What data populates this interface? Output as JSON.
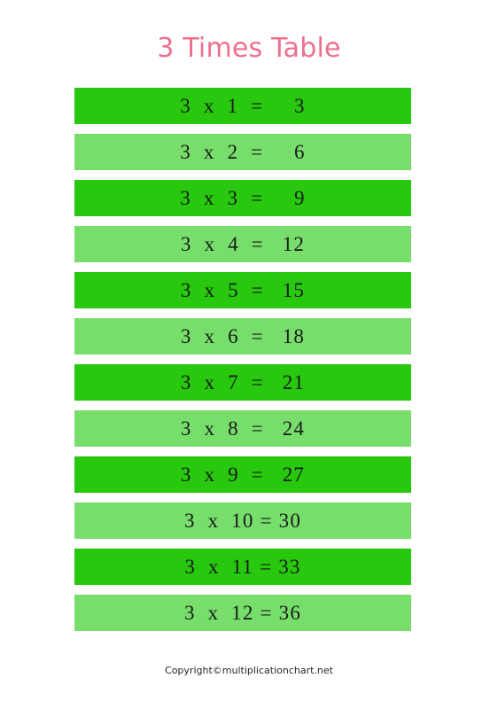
{
  "page": {
    "title": "3 Times Table",
    "title_color": "#ee6f90",
    "background_color": "#ffffff"
  },
  "colors": {
    "row_dark_green": "#27c80d",
    "row_light_green": "#77de6b",
    "text_color": "#1a1a1a"
  },
  "table": {
    "multiplier": "3",
    "operator": "x",
    "equals": "=",
    "rows": [
      {
        "line": "3  x  1  =     3",
        "multiplicand": "3",
        "multiplier": "1",
        "product": "3",
        "shade": "dark"
      },
      {
        "line": "3  x  2  =     6",
        "multiplicand": "3",
        "multiplier": "2",
        "product": "6",
        "shade": "light"
      },
      {
        "line": "3  x  3  =     9",
        "multiplicand": "3",
        "multiplier": "3",
        "product": "9",
        "shade": "dark"
      },
      {
        "line": "3  x  4  =   12",
        "multiplicand": "3",
        "multiplier": "4",
        "product": "12",
        "shade": "light"
      },
      {
        "line": "3  x  5  =   15",
        "multiplicand": "3",
        "multiplier": "5",
        "product": "15",
        "shade": "dark"
      },
      {
        "line": "3  x  6  =   18",
        "multiplicand": "3",
        "multiplier": "6",
        "product": "18",
        "shade": "light"
      },
      {
        "line": "3  x  7  =   21",
        "multiplicand": "3",
        "multiplier": "7",
        "product": "21",
        "shade": "dark"
      },
      {
        "line": "3  x  8  =   24",
        "multiplicand": "3",
        "multiplier": "8",
        "product": "24",
        "shade": "light"
      },
      {
        "line": "3  x  9  =   27",
        "multiplicand": "3",
        "multiplier": "9",
        "product": "27",
        "shade": "dark"
      },
      {
        "line": "3  x  10 = 30",
        "multiplicand": "3",
        "multiplier": "10",
        "product": "30",
        "shade": "light"
      },
      {
        "line": "3  x  11 = 33",
        "multiplicand": "3",
        "multiplier": "11",
        "product": "33",
        "shade": "dark"
      },
      {
        "line": "3  x  12 = 36",
        "multiplicand": "3",
        "multiplier": "12",
        "product": "36",
        "shade": "light"
      }
    ]
  },
  "footer": {
    "copyright": "Copyright©multiplicationchart.net"
  }
}
